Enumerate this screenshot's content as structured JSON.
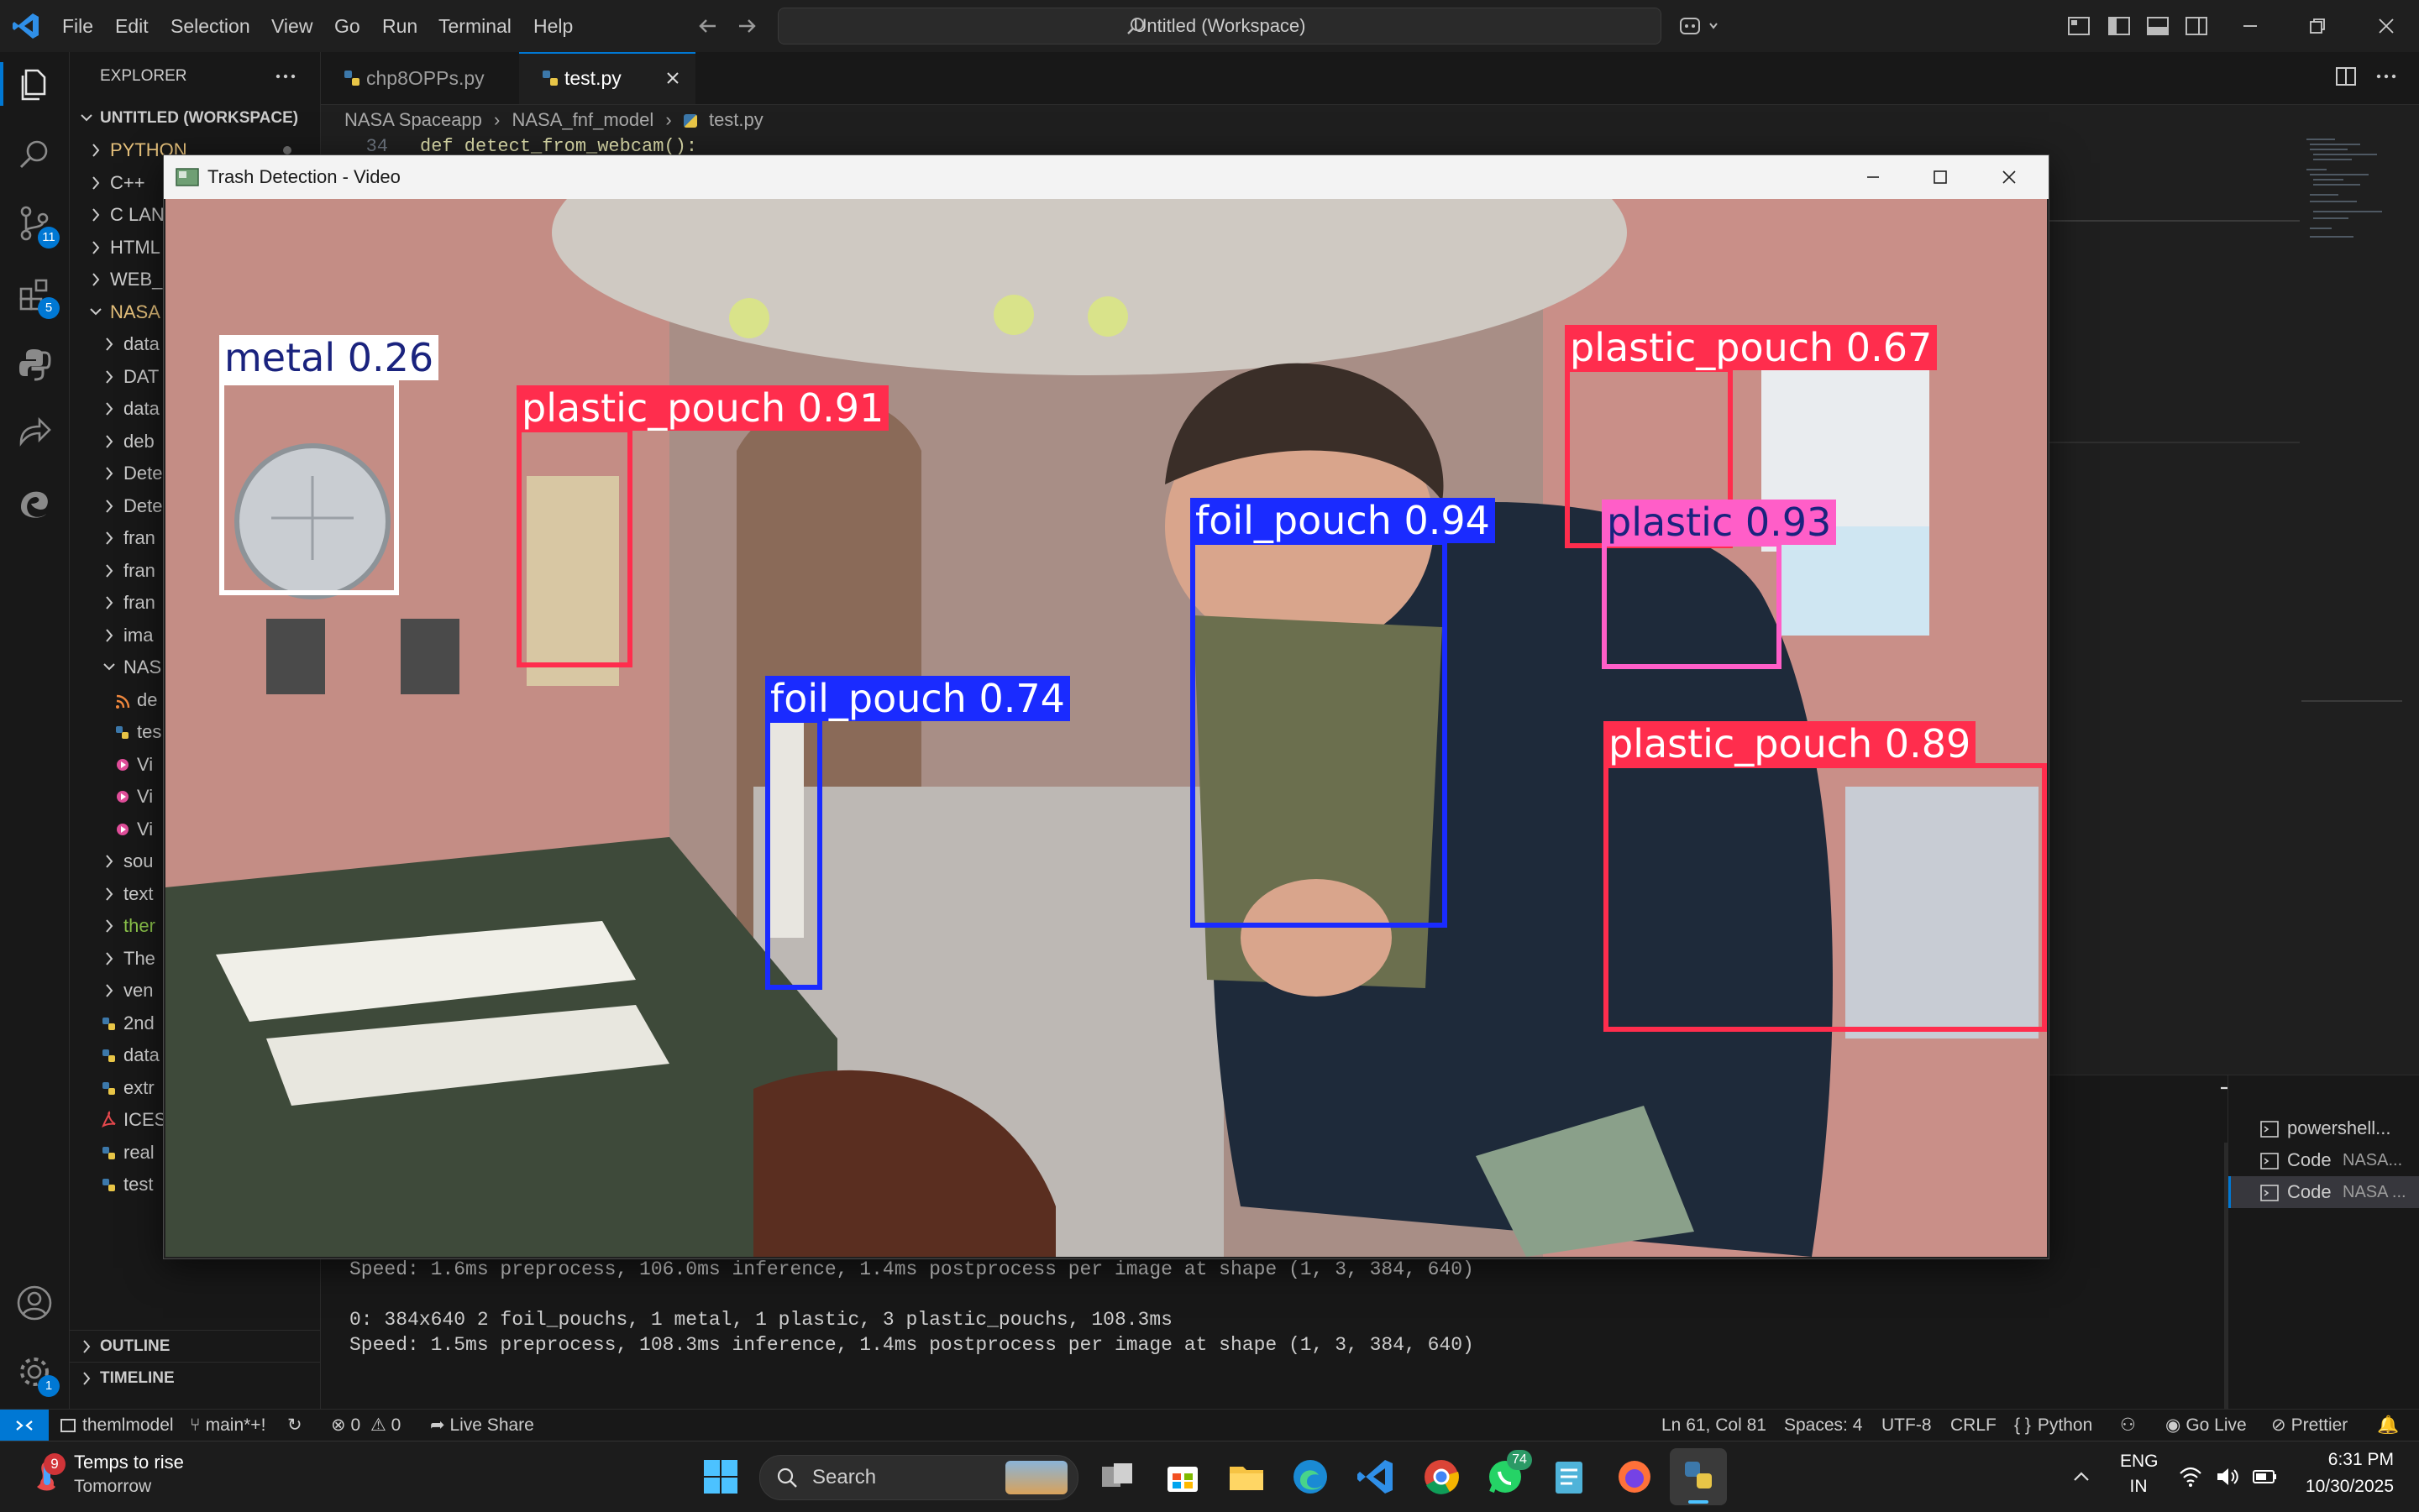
{
  "titlebar": {
    "menu": [
      "File",
      "Edit",
      "Selection",
      "View",
      "Go",
      "Run",
      "Terminal",
      "Help"
    ],
    "command_center": "Untitled (Workspace)"
  },
  "activity_bar": {
    "source_control_badge": "11",
    "extensions_badge": "5",
    "settings_badge": "1"
  },
  "sidebar": {
    "header": "EXPLORER",
    "workspace": "UNTITLED (WORKSPACE)",
    "items": [
      {
        "label": "PYTHON",
        "color": "#e5c07b"
      },
      {
        "label": "C++",
        "color": "#cccccc"
      },
      {
        "label": "C LAN",
        "color": "#cccccc"
      },
      {
        "label": "HTML",
        "color": "#cccccc"
      },
      {
        "label": "WEB_",
        "color": "#cccccc"
      },
      {
        "label": "NASA",
        "color": "#e5c07b"
      },
      {
        "label": "data",
        "color": "#cccccc"
      },
      {
        "label": "DAT",
        "color": "#cccccc"
      },
      {
        "label": "data",
        "color": "#cccccc"
      },
      {
        "label": "deb",
        "color": "#cccccc"
      },
      {
        "label": "Dete",
        "color": "#cccccc"
      },
      {
        "label": "Dete",
        "color": "#cccccc"
      },
      {
        "label": "fran",
        "color": "#cccccc"
      },
      {
        "label": "fran",
        "color": "#cccccc"
      },
      {
        "label": "fran",
        "color": "#cccccc"
      },
      {
        "label": "ima",
        "color": "#cccccc"
      },
      {
        "label": "NAS",
        "color": "#cccccc"
      },
      {
        "label": "de",
        "color": "#cccccc"
      },
      {
        "label": "tes",
        "color": "#cccccc"
      },
      {
        "label": "Vi",
        "color": "#cccccc"
      },
      {
        "label": "Vi",
        "color": "#cccccc"
      },
      {
        "label": "Vi",
        "color": "#cccccc"
      },
      {
        "label": "sou",
        "color": "#cccccc"
      },
      {
        "label": "text",
        "color": "#cccccc"
      },
      {
        "label": "ther",
        "color": "#8bc34a"
      },
      {
        "label": "The",
        "color": "#cccccc"
      },
      {
        "label": "ven",
        "color": "#cccccc"
      },
      {
        "label": "2nd",
        "color": "#cccccc"
      },
      {
        "label": "data",
        "color": "#cccccc"
      },
      {
        "label": "extr",
        "color": "#cccccc"
      },
      {
        "label": "ICES",
        "color": "#cccccc"
      },
      {
        "label": "real",
        "color": "#cccccc"
      },
      {
        "label": "test",
        "color": "#cccccc"
      }
    ],
    "outline": "OUTLINE",
    "timeline": "TIMELINE"
  },
  "editor": {
    "tabs": [
      {
        "label": "chp8OPPs.py",
        "active": false
      },
      {
        "label": "test.py",
        "active": true
      }
    ],
    "breadcrumb": [
      "NASA Spaceapp",
      "NASA_fnf_model",
      "test.py"
    ],
    "line_number": "34",
    "code_line": "def detect_from_webcam():"
  },
  "video_window": {
    "title": "Trash Detection - Video",
    "detections": [
      {
        "label": "metal 0.26",
        "color": "#ffffff",
        "label_text_color": "#1a237e"
      },
      {
        "label": "plastic_pouch 0.91",
        "color": "#ff2d4d",
        "label_text_color": "#ffffff"
      },
      {
        "label": "foil_pouch 0.74",
        "color": "#1a2bff",
        "label_text_color": "#ffffff"
      },
      {
        "label": "foil_pouch 0.94",
        "color": "#1a2bff",
        "label_text_color": "#ffffff"
      },
      {
        "label": "plastic_pouch 0.67",
        "color": "#ff2d4d",
        "label_text_color": "#ffffff"
      },
      {
        "label": "plastic 0.93",
        "color": "#ff5ec8",
        "label_text_color": "#1a237e"
      },
      {
        "label": "plastic_pouch 0.89",
        "color": "#ff2d4d",
        "label_text_color": "#ffffff"
      }
    ]
  },
  "terminal": {
    "lines": [
      "Speed: 1.6ms preprocess, 106.0ms inference, 1.4ms postprocess per image at shape (1, 3, 384, 640)",
      "",
      "0: 384x640 2 foil_pouchs, 1 metal, 1 plastic, 3 plastic_pouchs, 108.3ms",
      "Speed: 1.5ms preprocess, 108.3ms inference, 1.4ms postprocess per image at shape (1, 3, 384, 640)"
    ],
    "sessions": [
      {
        "name": "powershell...",
        "sub": ""
      },
      {
        "name": "Code",
        "sub": "NASA..."
      },
      {
        "name": "Code",
        "sub": "NASA ..."
      }
    ]
  },
  "statusbar": {
    "remote": "themlmodel",
    "branch": "main*+!",
    "errors": "0",
    "warnings": "0",
    "live_share": "Live Share",
    "position": "Ln 61, Col 81",
    "spaces": "Spaces: 4",
    "encoding": "UTF-8",
    "eol": "CRLF",
    "language": "Python",
    "go_live": "Go Live",
    "prettier": "Prettier"
  },
  "taskbar": {
    "weather_title": "Temps to rise",
    "weather_sub": "Tomorrow",
    "weather_badge": "9",
    "search": "Search",
    "whatsapp_badge": "74",
    "lang": "ENG",
    "region": "IN",
    "time": "6:31 PM",
    "date": "10/30/2025"
  }
}
